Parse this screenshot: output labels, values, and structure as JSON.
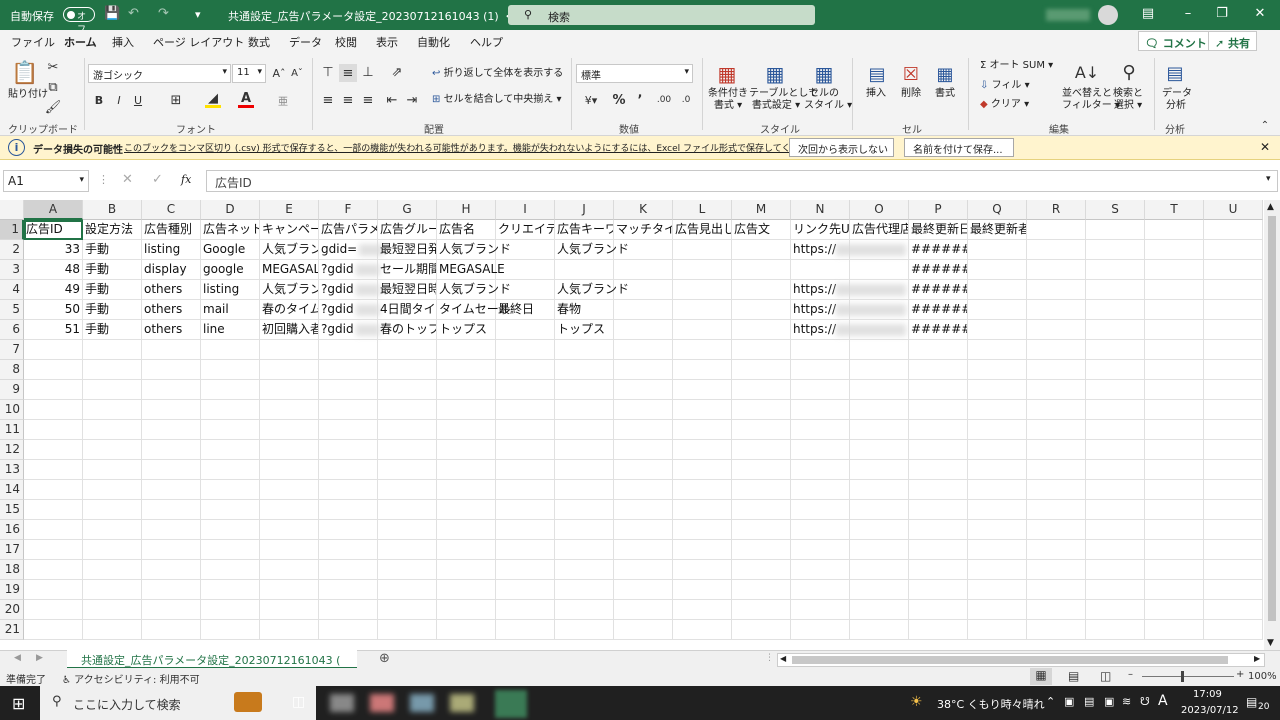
{
  "titlebar": {
    "autosave_label": "自動保存",
    "autosave_state": "オフ",
    "file_title": "共通設定_広告パラメータ設定_20230712161043 (1)  ・・・",
    "search_placeholder": "検索"
  },
  "menu": {
    "tabs": [
      "ファイル",
      "ホーム",
      "挿入",
      "ページ レイアウト",
      "数式",
      "データ",
      "校閲",
      "表示",
      "自動化",
      "ヘルプ"
    ],
    "active_tab": "ホーム",
    "comment_label": "コメント",
    "share_label": "共有"
  },
  "ribbon": {
    "clipboard": {
      "paste": "貼り付け",
      "group": "クリップボード"
    },
    "font": {
      "name": "游ゴシック",
      "size": "11",
      "bold": "B",
      "italic": "I",
      "underline": "U",
      "group": "フォント"
    },
    "alignment": {
      "wrap": "折り返して全体を表示する",
      "merge": "セルを結合して中央揃え",
      "group": "配置"
    },
    "number": {
      "format": "標準",
      "group": "数値"
    },
    "styles": {
      "conditional1": "条件付き",
      "conditional2": "書式",
      "table1": "テーブルとして",
      "table2": "書式設定",
      "cell1": "セルの",
      "cell2": "スタイル",
      "group": "スタイル"
    },
    "cells": {
      "insert": "挿入",
      "delete": "削除",
      "format": "書式",
      "group": "セル"
    },
    "editing": {
      "autosum": "オート SUM",
      "fill": "フィル",
      "clear": "クリア",
      "sort1": "並べ替えと",
      "sort2": "フィルター",
      "find1": "検索と",
      "find2": "選択",
      "group": "編集"
    },
    "analysis": {
      "data1": "データ",
      "data2": "分析",
      "group": "分析"
    }
  },
  "infobar": {
    "title": "データ損失の可能性",
    "message": "このブックをコンマ区切り (.csv) 形式で保存すると、一部の機能が失われる可能性があります。機能が失われないようにするには、Excel ファイル形式で保存してください。",
    "dont_show": "次回から表示しない",
    "save_as": "名前を付けて保存..."
  },
  "formula_bar": {
    "cell_ref": "A1",
    "fx": "fx",
    "content": "広告ID"
  },
  "columns": [
    "A",
    "B",
    "C",
    "D",
    "E",
    "F",
    "G",
    "H",
    "I",
    "J",
    "K",
    "L",
    "M",
    "N",
    "O",
    "P",
    "Q",
    "R",
    "S",
    "T",
    "U"
  ],
  "row_numbers": [
    "1",
    "2",
    "3",
    "4",
    "5",
    "6",
    "7",
    "8",
    "9",
    "10",
    "11",
    "12",
    "13",
    "14",
    "15",
    "16",
    "17",
    "18",
    "19",
    "20",
    "21"
  ],
  "header_row": [
    "広告ID",
    "設定方法",
    "広告種別",
    "広告ネット",
    "キャンペー",
    "広告パラメ",
    "広告グルー",
    "広告名",
    "クリエイテ",
    "広告キーワ",
    "マッチタイ",
    "広告見出し",
    "広告文",
    "リンク先U",
    "広告代理店",
    "最終更新日",
    "最終更新者"
  ],
  "rows": [
    {
      "A": "33",
      "B": "手動",
      "C": "listing",
      "D": "Google",
      "E": "人気ブラン",
      "F": "gdid=",
      "G": "最短翌日発",
      "H": "人気ブランド",
      "I": "",
      "J": "人気ブランド",
      "N": "https://",
      "P": "########"
    },
    {
      "A": "48",
      "B": "手動",
      "C": "display",
      "D": "google",
      "E": "MEGASAL",
      "F": "?gdid",
      "G": "セール期間",
      "H": "MEGASALE",
      "I": "",
      "J": "",
      "N": "",
      "P": "########"
    },
    {
      "A": "49",
      "B": "手動",
      "C": "others",
      "D": "listing",
      "E": "人気ブラン",
      "F": "?gdid",
      "G": "最短翌日時",
      "H": "人気ブランド",
      "I": "",
      "J": "人気ブランド",
      "N": "https://",
      "P": "########"
    },
    {
      "A": "50",
      "B": "手動",
      "C": "others",
      "D": "mail",
      "E": "春のタイム",
      "F": "?gdid",
      "G": "4日間タイ",
      "H": "タイムセール",
      "I": "最終日",
      "J": "春物",
      "N": "https://",
      "P": "########"
    },
    {
      "A": "51",
      "B": "手動",
      "C": "others",
      "D": "line",
      "E": "初回購入者",
      "F": "?gdid",
      "G": "春のトップ",
      "H": "トップス",
      "I": "",
      "J": "トップス",
      "N": "https://",
      "P": "########"
    }
  ],
  "sheet_tab": "共通設定_広告パラメータ設定_20230712161043 (",
  "status": {
    "ready": "準備完了",
    "accessibility": "アクセシビリティ: 利用不可",
    "zoom": "100%"
  },
  "taskbar": {
    "search_placeholder": "ここに入力して検索",
    "weather": "38°C  くもり時々晴れ",
    "time": "17:09",
    "date": "2023/07/12",
    "ime": "A",
    "notif": "20"
  }
}
